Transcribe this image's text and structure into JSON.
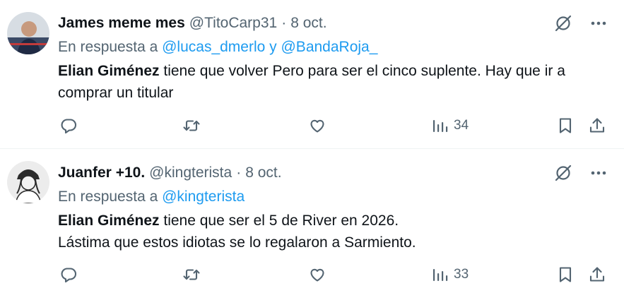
{
  "tweets": [
    {
      "name": "James meme mes",
      "handle": "@TitoCarp31",
      "dot": "·",
      "date": "8 oct.",
      "reply_prefix": "En respuesta a",
      "reply_mentions": "@lucas_dmerlo y @BandaRoja_",
      "text_bold": "Elian Giménez",
      "text_rest": " tiene que volver Pero para ser el cinco suplente. Hay que ir a comprar un titular",
      "views": "34",
      "icons": [
        "grok-icon",
        "more-icon",
        "reply-icon",
        "retweet-icon",
        "like-icon",
        "views-icon",
        "bookmark-icon",
        "share-icon"
      ]
    },
    {
      "name": "Juanfer +10.",
      "handle": "@kingterista",
      "dot": "·",
      "date": "8 oct.",
      "reply_prefix": "En respuesta a",
      "reply_mentions": "@kingterista",
      "text_bold": "Elian Giménez",
      "text_rest": " tiene que ser el 5 de River en 2026.\nLástima que estos idiotas se lo regalaron a Sarmiento.",
      "views": "33",
      "icons": [
        "grok-icon",
        "more-icon",
        "reply-icon",
        "retweet-icon",
        "like-icon",
        "views-icon",
        "bookmark-icon",
        "share-icon"
      ]
    }
  ],
  "colors": {
    "text": "#0f1419",
    "secondary": "#536471",
    "link": "#1d9bf0",
    "divider": "#eff3f4"
  }
}
